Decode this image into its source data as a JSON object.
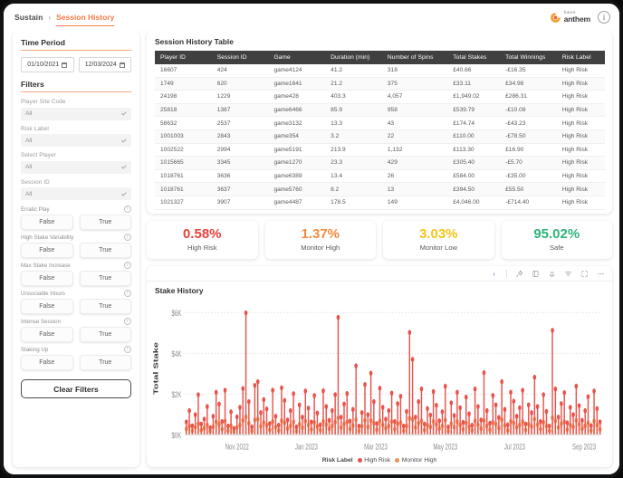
{
  "header": {
    "breadcrumb_root": "Sustain",
    "breadcrumb_sep": "›",
    "breadcrumb_active": "Session History",
    "logo_top": "future",
    "logo_bottom": "anthem",
    "info_icon": "i"
  },
  "sidebar": {
    "time_period_title": "Time Period",
    "date_from": "01/10/2021",
    "date_to": "12/03/2024",
    "filters_title": "Filters",
    "fields": [
      {
        "label": "Player Site Code",
        "value": "All"
      },
      {
        "label": "Risk Label",
        "value": "All"
      },
      {
        "label": "Select Player",
        "value": "All"
      },
      {
        "label": "Session ID",
        "value": "All"
      }
    ],
    "toggles": [
      {
        "label": "Erratic Play",
        "false_label": "False",
        "true_label": "True"
      },
      {
        "label": "High Stake Variability",
        "false_label": "False",
        "true_label": "True"
      },
      {
        "label": "Max Stake Increase",
        "false_label": "False",
        "true_label": "True"
      },
      {
        "label": "Unsociable Hours",
        "false_label": "False",
        "true_label": "True"
      },
      {
        "label": "Intense Session",
        "false_label": "False",
        "true_label": "True"
      },
      {
        "label": "Staking Up",
        "false_label": "False",
        "true_label": "True"
      }
    ],
    "info_icon": "i",
    "clear_filters": "Clear Filters"
  },
  "table": {
    "title": "Session History Table",
    "columns": [
      "Player ID",
      "Session ID",
      "Game",
      "Duration (min)",
      "Number of Spins",
      "Total Stakes",
      "Total Winnings",
      "Risk Label"
    ],
    "rows": [
      [
        "16607",
        "424",
        "game4124",
        "41.2",
        "318",
        "£40.66",
        "-£16.35",
        "High Risk"
      ],
      [
        "1749",
        "620",
        "game1641",
        "21.2",
        "375",
        "£33.11",
        "£34.98",
        "High Risk"
      ],
      [
        "24198",
        "1229",
        "game428",
        "403.3",
        "4,057",
        "£1,949.02",
        "£286.31",
        "High Risk"
      ],
      [
        "25818",
        "1387",
        "game6466",
        "85.9",
        "958",
        "£539.79",
        "-£10.08",
        "High Risk"
      ],
      [
        "58632",
        "2537",
        "game3132",
        "13.3",
        "43",
        "£174.74",
        "-£43.23",
        "High Risk"
      ],
      [
        "1001003",
        "2843",
        "game354",
        "3.2",
        "22",
        "£110.00",
        "-£78.50",
        "High Risk"
      ],
      [
        "1002522",
        "2994",
        "game5191",
        "213.9",
        "1,132",
        "£113.30",
        "£16.90",
        "High Risk"
      ],
      [
        "1015665",
        "3345",
        "game1270",
        "23.3",
        "429",
        "£305.40",
        "-£5.70",
        "High Risk"
      ],
      [
        "1018761",
        "3636",
        "game6389",
        "13.4",
        "26",
        "£584.00",
        "-£35.00",
        "High Risk"
      ],
      [
        "1018761",
        "3637",
        "game5760",
        "8.2",
        "13",
        "£394.50",
        "£55.50",
        "High Risk"
      ],
      [
        "1021327",
        "3907",
        "game4487",
        "178.5",
        "149",
        "£4,046.00",
        "-£714.40",
        "High Risk"
      ]
    ]
  },
  "kpis": [
    {
      "value": "0.58%",
      "label": "High Risk",
      "color": "#e8413c"
    },
    {
      "value": "1.37%",
      "label": "Monitor High",
      "color": "#f58a3c"
    },
    {
      "value": "3.03%",
      "label": "Monitor Low",
      "color": "#f5c518"
    },
    {
      "value": "95.02%",
      "label": "Safe",
      "color": "#2fb37a"
    }
  ],
  "chart_toolbar": {
    "icons": [
      "info-icon",
      "pin-icon",
      "book-icon",
      "bell-icon",
      "filter-icon",
      "expand-icon",
      "more-icon"
    ]
  },
  "chart_data": {
    "type": "bar",
    "title": "Stake History",
    "xlabel": "",
    "ylabel": "Total Stake",
    "ylim": [
      0,
      6500
    ],
    "yticks": [
      "$0K",
      "$2K",
      "$4K",
      "$6K"
    ],
    "ytick_values": [
      0,
      2000,
      4000,
      6000
    ],
    "xticks": [
      "Nov 2022",
      "Jan 2023",
      "Mar 2023",
      "May 2023",
      "Jul 2023",
      "Sep 2023"
    ],
    "grid": true,
    "legend_title": "Risk Label",
    "legend_position": "bottom",
    "series": [
      {
        "name": "High Risk",
        "color": "#e8534c",
        "values": [
          620,
          1180,
          430,
          980,
          1960,
          520,
          760,
          1380,
          340,
          900,
          2080,
          1500,
          640,
          2180,
          420,
          1120,
          300,
          870,
          1340,
          2260,
          5980,
          1620,
          380,
          2420,
          2600,
          1080,
          1720,
          1260,
          540,
          2180,
          900,
          460,
          2300,
          1680,
          720,
          1180,
          2010,
          380,
          1460,
          860,
          2140,
          1300,
          620,
          1920,
          1060,
          480,
          2150,
          1380,
          700,
          1180,
          1960,
          5760,
          860,
          1500,
          2020,
          660,
          1240,
          3380,
          420,
          1080,
          2460,
          980,
          3020,
          1620,
          540,
          2280,
          1340,
          760,
          1180,
          2040,
          640,
          1520,
          1880,
          420,
          1140,
          5020,
          3700,
          860,
          1620,
          2240,
          520,
          1280,
          960,
          2120,
          1440,
          680,
          1120,
          2380,
          380,
          1560,
          940,
          2080,
          1320,
          600,
          1840,
          1020,
          460,
          2240,
          1380,
          720,
          3040,
          1180,
          560,
          1920,
          1460,
          840,
          2600,
          1240,
          480,
          2080,
          1640,
          900,
          1320,
          2180,
          520,
          1460,
          1080,
          2820,
          1380,
          640,
          1960,
          1140,
          420,
          5120,
          2240,
          860,
          1520,
          2060,
          580,
          1340,
          980,
          2380,
          1420,
          700,
          1180,
          1860,
          440,
          2140,
          1280,
          620
        ]
      },
      {
        "name": "Monitor High",
        "color": "#ef9355",
        "values": [
          280,
          420,
          190,
          360,
          540,
          230,
          310,
          480,
          160,
          390,
          620,
          500,
          270,
          660,
          200,
          430,
          140,
          350,
          470,
          700,
          880,
          560,
          180,
          720,
          760,
          410,
          590,
          450,
          240,
          640,
          370,
          210,
          690,
          580,
          300,
          440,
          620,
          170,
          510,
          340,
          660,
          470,
          260,
          600,
          400,
          220,
          650,
          490,
          290,
          430,
          610,
          820,
          350,
          520,
          630,
          280,
          450,
          740,
          190,
          410,
          700,
          380,
          690,
          560,
          240,
          670,
          480,
          310,
          430,
          640,
          270,
          530,
          590,
          190,
          420,
          800,
          750,
          350,
          560,
          680,
          230,
          460,
          380,
          650,
          500,
          290,
          430,
          710,
          170,
          540,
          370,
          640,
          470,
          260,
          580,
          390,
          210,
          680,
          490,
          300,
          690,
          430,
          240,
          600,
          510,
          330,
          720,
          450,
          210,
          650,
          570,
          360,
          470,
          640,
          230,
          510,
          400,
          760,
          490,
          270,
          610,
          420,
          190,
          830,
          680,
          350,
          530,
          630,
          250,
          470,
          380,
          700,
          500,
          290,
          430,
          580,
          200,
          660,
          460,
          260
        ]
      }
    ]
  }
}
